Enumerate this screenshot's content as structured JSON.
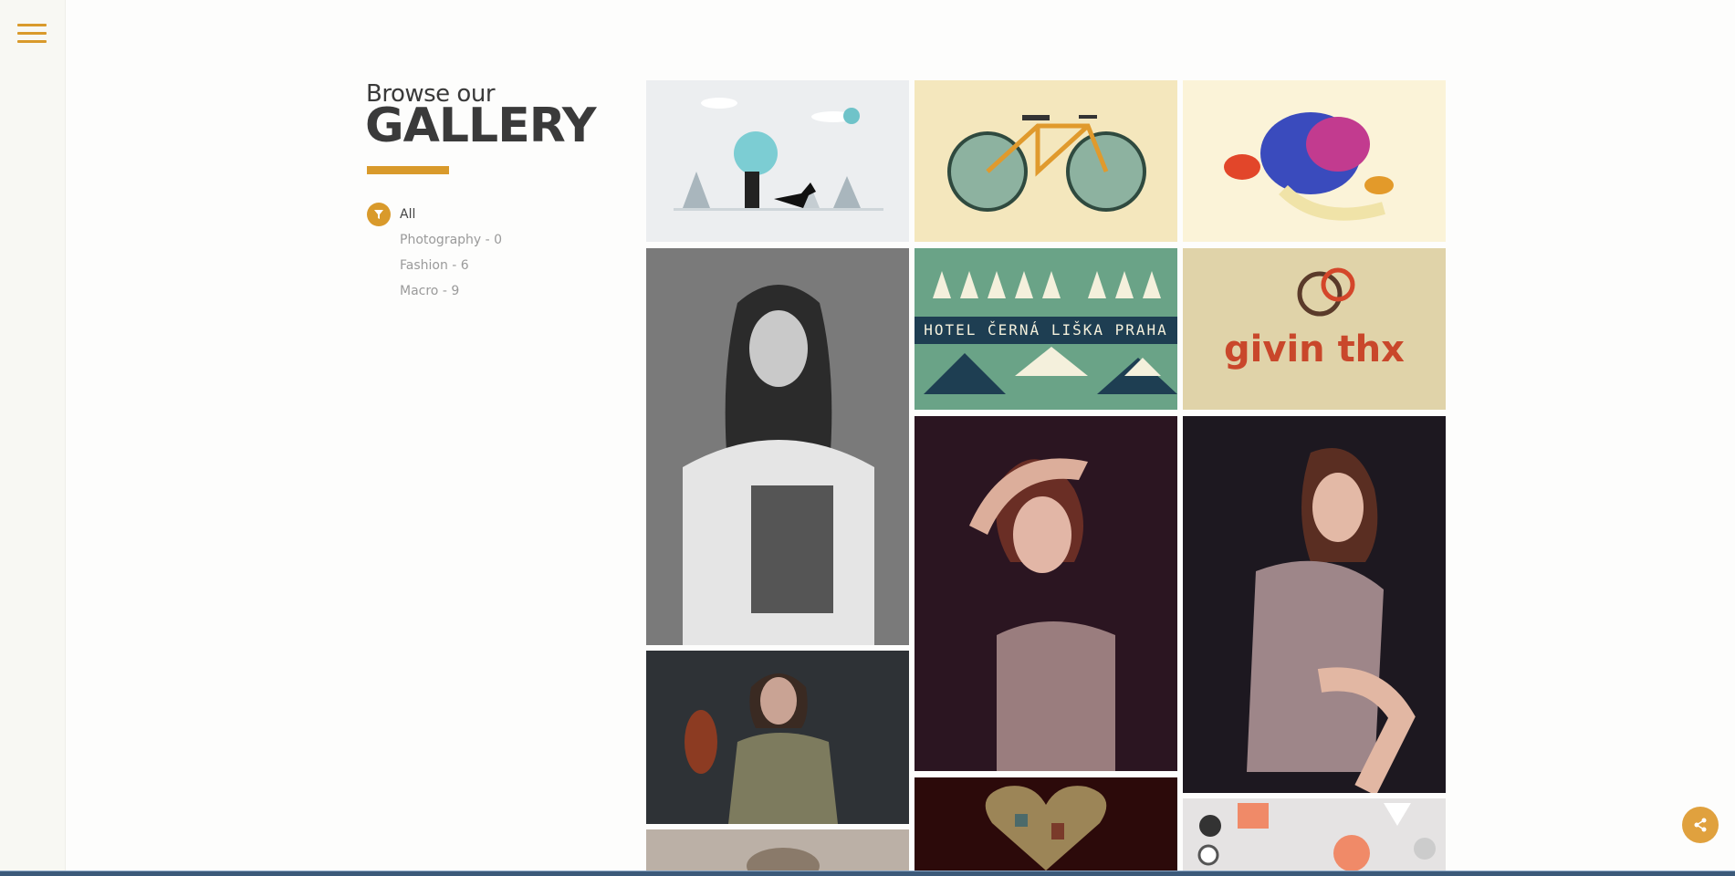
{
  "sidebar": {
    "menu_icon": "hamburger-menu-icon"
  },
  "header": {
    "subtitle": "Browse our",
    "title": "GALLERY"
  },
  "filters": {
    "icon": "filter-icon",
    "items": [
      {
        "label": "All",
        "active": true
      },
      {
        "label": "Photography - 0",
        "active": false
      },
      {
        "label": "Fashion - 6",
        "active": false
      },
      {
        "label": "Macro - 9",
        "active": false
      }
    ]
  },
  "gallery": {
    "tiles": [
      {
        "subject": "illustration-winter-fox"
      },
      {
        "subject": "illustration-globe-bicycle"
      },
      {
        "subject": "illustration-colorful-creatures"
      },
      {
        "subject": "photo-woman-bw"
      },
      {
        "subject": "illustration-hotel-poster",
        "text": "HOTEL ČERNÁ LIŠKA PRAHA"
      },
      {
        "subject": "illustration-typography-logo",
        "text": "givin thx"
      },
      {
        "subject": "photo-woman-posing"
      },
      {
        "subject": "photo-woman-dress"
      },
      {
        "subject": "photo-woman-trench-coat"
      },
      {
        "subject": "illustration-heart-city"
      },
      {
        "subject": "illustration-halloween"
      },
      {
        "subject": "photo-blurred"
      }
    ]
  },
  "colors": {
    "accent": "#d99a2b",
    "text": "#3a3a3a",
    "muted": "#9a9a9a"
  },
  "share": {
    "icon": "share-icon"
  }
}
